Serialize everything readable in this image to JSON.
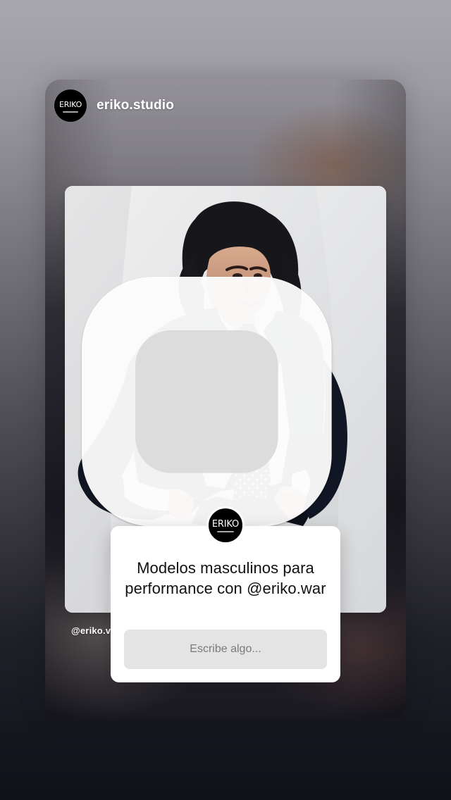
{
  "story": {
    "username": "eriko.studio",
    "caption": "@eriko.v",
    "avatar_logo": "ERIKO",
    "photo_corner_icon": "square-icon"
  },
  "question_sticker": {
    "avatar_logo": "ERIKO",
    "text": "Modelos masculinos para performance con @eriko.war",
    "placeholder": "Escribe algo..."
  },
  "colors": {
    "sticker_background": "#ffffff",
    "input_background": "#e4e4e4",
    "text_primary": "#111111",
    "placeholder_text": "#7a7a7a"
  }
}
